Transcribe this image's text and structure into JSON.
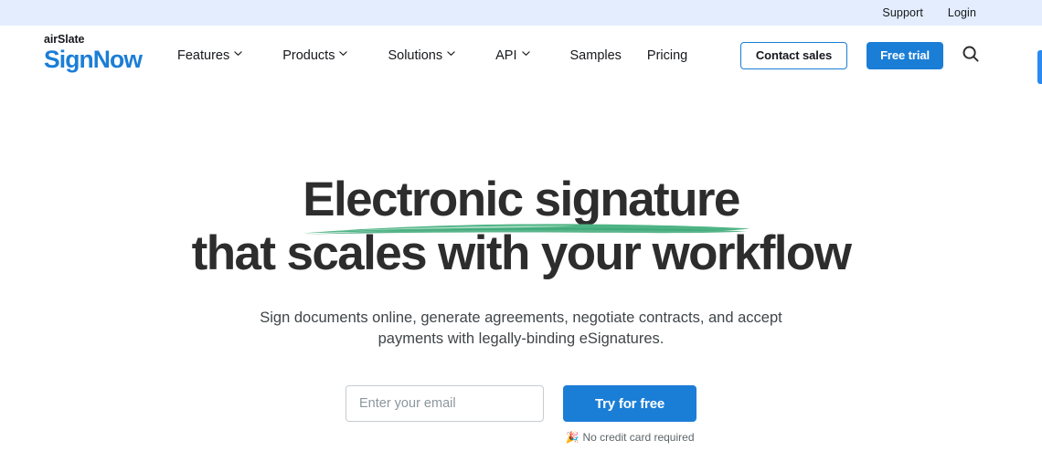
{
  "utility_bar": {
    "links": [
      {
        "label": "Support",
        "name": "support-link"
      },
      {
        "label": "Login",
        "name": "login-link"
      }
    ],
    "background": "#e3edfd"
  },
  "header": {
    "logo": {
      "top_text": "airSlate",
      "main_text": "SignNow",
      "main_color": "#1b7ed6"
    },
    "nav": [
      {
        "label": "Features",
        "has_caret": true
      },
      {
        "label": "Products",
        "has_caret": true
      },
      {
        "label": "Solutions",
        "has_caret": true
      },
      {
        "label": "API",
        "has_caret": true
      },
      {
        "label": "Samples",
        "has_caret": false
      },
      {
        "label": "Pricing",
        "has_caret": false
      }
    ],
    "contact_sales_label": "Contact sales",
    "free_trial_label": "Free trial",
    "search_icon": "search-icon",
    "accent_color": "#1b7ed6"
  },
  "side_tab": {
    "color": "#2a8af0"
  },
  "hero": {
    "title_line_1": "Electronic signature",
    "title_line_2": "that scales with your workflow",
    "underline_color": "#4fb485",
    "subtitle": "Sign documents online, generate agreements, negotiate contracts, and accept payments with legally-binding eSignatures.",
    "email_placeholder": "Enter your email",
    "email_value": "",
    "cta_label": "Try for free",
    "note_emoji": "🎉",
    "note_text": "No credit card required"
  }
}
